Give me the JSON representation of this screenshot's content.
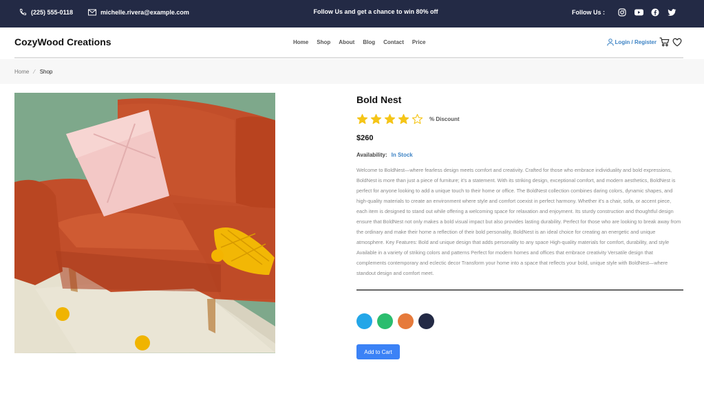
{
  "topbar": {
    "phone": "(225) 555-0118",
    "email": "michelle.rivera@example.com",
    "promo": "Follow Us and get a chance to win 80% off",
    "follow_label": "Follow Us :",
    "socials": [
      "instagram-icon",
      "youtube-icon",
      "facebook-icon",
      "twitter-icon"
    ]
  },
  "nav": {
    "brand": "CozyWood Creations",
    "menu": [
      "Home",
      "Shop",
      "About",
      "Blog",
      "Contact",
      "Price"
    ],
    "login": "Login / Register"
  },
  "breadcrumb": {
    "home": "Home",
    "separator": "⁄",
    "current": "Shop"
  },
  "product": {
    "title": "Bold Nest",
    "rating": 4,
    "rating_max": 5,
    "discount": "% Discount",
    "price": "$260",
    "availability_label": "Availability:",
    "availability_value": "In Stock",
    "description": "Welcome to BoldNest—where fearless design meets comfort and creativity. Crafted for those who embrace individuality and bold expressions, BoldNest is more than just a piece of furniture; it's a statement. With its striking design, exceptional comfort, and modern aesthetics, BoldNest is perfect for anyone looking to add a unique touch to their home or office. The BoldNest collection combines daring colors, dynamic shapes, and high-quality materials to create an environment where style and comfort coexist in perfect harmony. Whether it's a chair, sofa, or accent piece, each item is designed to stand out while offering a welcoming space for relaxation and enjoyment. Its sturdy construction and thoughtful design ensure that BoldNest not only makes a bold visual impact but also provides lasting durability. Perfect for those who are looking to break away from the ordinary and make their home a reflection of their bold personality, BoldNest is an ideal choice for creating an energetic and unique atmosphere. Key Features: Bold and unique design that adds personality to any space High-quality materials for comfort, durability, and style Available in a variety of striking colors and patterns Perfect for modern homes and offices that embrace creativity Versatile design that complements contemporary and eclectic decor Transform your home into a space that reflects your bold, unique style with BoldNest—where standout design and comfort meet.",
    "swatches": [
      "#23a6e8",
      "#2bbd6e",
      "#e67a3b",
      "#232a45"
    ],
    "add_to_cart": "Add to Cart"
  },
  "colors": {
    "topbar_bg": "#232a45",
    "accent": "#3b82f6",
    "star": "#f5c518"
  }
}
